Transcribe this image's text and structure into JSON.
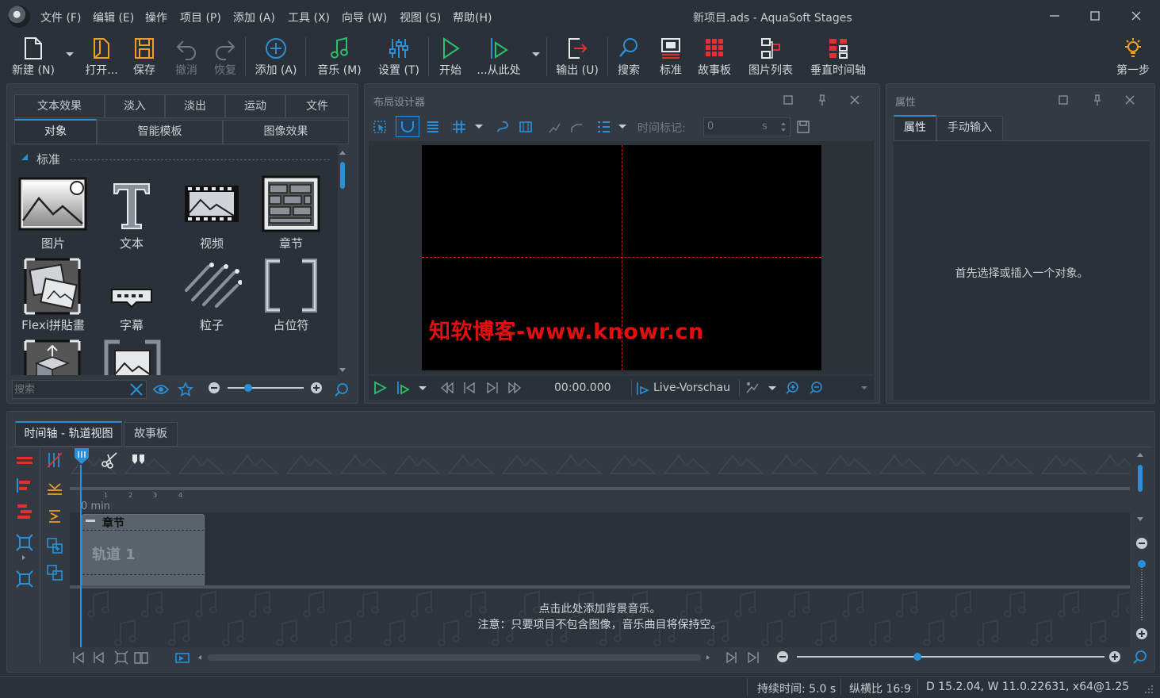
{
  "window": {
    "title": "新项目.ads - AquaSoft Stages",
    "menu": [
      "文件 (F)",
      "编辑 (E)",
      "操作",
      "项目 (P)",
      "添加 (A)",
      "工具 (X)",
      "向导 (W)",
      "视图 (S)",
      "帮助(H)"
    ]
  },
  "toolbar": {
    "new": "新建 (N)",
    "open": "打开...",
    "save": "保存",
    "undo": "撤消",
    "redo": "恢复",
    "add": "添加 (A)",
    "music": "音乐 (M)",
    "settings": "设置 (T)",
    "start": "开始",
    "from_here": "...从此处",
    "output": "输出 (U)",
    "search": "搜索",
    "standard": "标准",
    "storyboard": "故事板",
    "image_list": "图片列表",
    "vertical_timeline": "垂直时间轴",
    "first_step": "第一步"
  },
  "objects_panel": {
    "tabs_row1": [
      "文本效果",
      "淡入",
      "淡出",
      "运动",
      "文件"
    ],
    "tabs_row2": [
      "对象",
      "智能模板",
      "图像效果"
    ],
    "section": "标准",
    "items": [
      "图片",
      "文本",
      "视频",
      "章节",
      "Flexi拼貼畫",
      "字幕",
      "粒子",
      "占位符"
    ],
    "search_placeholder": "搜索",
    "zoom_fraction": 0.25
  },
  "layout_designer": {
    "title": "布局设计器",
    "time_marker_label": "时间标记:",
    "time_marker_value": "0",
    "time_marker_unit": "s",
    "watermark": "知软博客-www.knowr.cn",
    "time": "00:00.000",
    "live_preview": "Live-Vorschau"
  },
  "properties": {
    "title": "属性",
    "tabs": [
      "属性",
      "手动输入"
    ],
    "empty_message": "首先选择或插入一个对象。"
  },
  "timeline": {
    "tabs": [
      "时间轴 - 轨道视图",
      "故事板"
    ],
    "ruler_start": "0 min",
    "ruler_ticks": [
      "1",
      "2",
      "3",
      "4"
    ],
    "chapter_label": "章节",
    "track_label": "轨道 1",
    "music_hint_1": "点击此处添加背景音乐。",
    "music_hint_2": "注意：只要项目不包含图像，音乐曲目将保持空。",
    "zoom_fraction": 0.39
  },
  "statusbar": {
    "duration": "持续时间: 5.0 s",
    "aspect": "纵横比 16:9",
    "version": "D 15.2.04, W 11.0.22631, x64@1.25"
  },
  "colors": {
    "accent": "#2a8fd6",
    "play_green": "#2dbf6d",
    "red_watermark": "#e01010",
    "guide_red": "#c81e1e"
  }
}
